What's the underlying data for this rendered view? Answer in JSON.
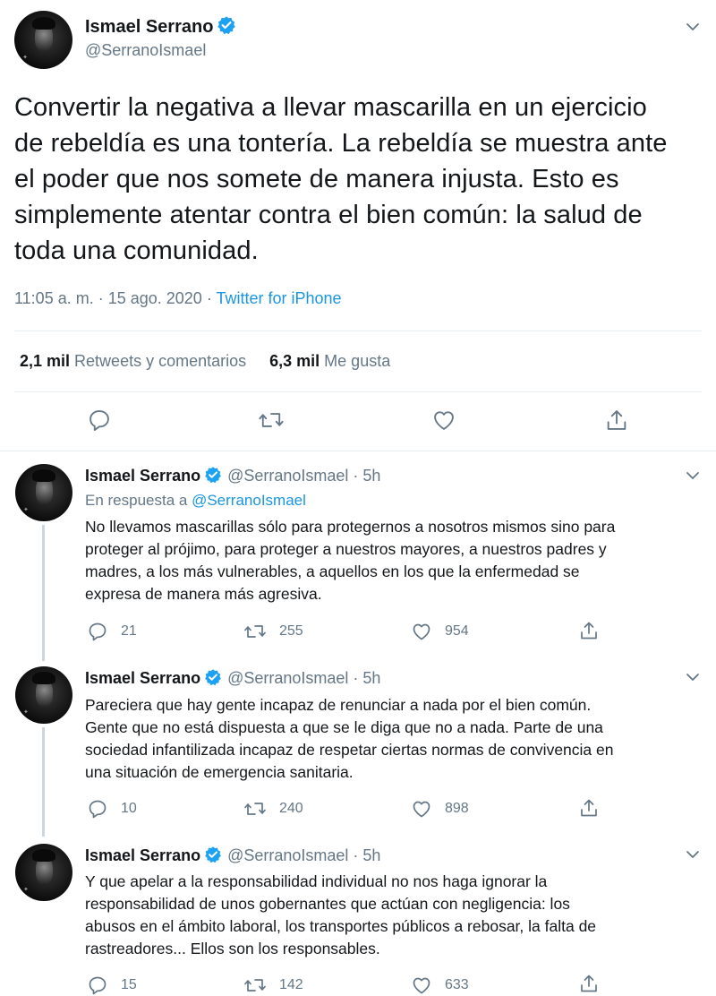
{
  "main_tweet": {
    "name": "Ismael Serrano",
    "handle": "@SerranoIsmael",
    "text_lines": [
      "Convertir la negativa a llevar mascarilla en un ejercicio",
      "de rebeldía es una tontería. La rebeldía se muestra ante",
      "el poder que nos somete de manera injusta. Esto es",
      "simplemente atentar contra el bien común: la salud de",
      "toda una comunidad."
    ],
    "time": "11:05 a. m. · 15 ago. 2020 · ",
    "source": "Twitter for iPhone",
    "retweets_count": "2,1 mil",
    "retweets_label": "Retweets y comentarios",
    "likes_count": "6,3 mil",
    "likes_label": "Me gusta"
  },
  "replies": [
    {
      "name": "Ismael Serrano",
      "handle": "@SerranoIsmael · 5h",
      "in_reply_prefix": "En respuesta a ",
      "in_reply_handle": "@SerranoIsmael",
      "text_lines": [
        "No llevamos mascarillas sólo para protegernos a nosotros mismos sino para",
        "proteger al prójimo, para proteger a nuestros mayores, a nuestros padres y",
        "madres, a los más vulnerables, a aquellos en los que la enfermedad se",
        "expresa de manera más agresiva."
      ],
      "replies": "21",
      "retweets": "255",
      "likes": "954"
    },
    {
      "name": "Ismael Serrano",
      "handle": "@SerranoIsmael · 5h",
      "text_lines": [
        "Pareciera que hay gente incapaz de renunciar a nada por el bien común.",
        "Gente que no está dispuesta a que se le diga que no a nada. Parte de una",
        "sociedad infantilizada incapaz de respetar ciertas normas de convivencia en",
        "una situación de emergencia sanitaria."
      ],
      "replies": "10",
      "retweets": "240",
      "likes": "898"
    },
    {
      "name": "Ismael Serrano",
      "handle": "@SerranoIsmael · 5h",
      "text_lines": [
        "Y que apelar a la responsabilidad individual no nos haga ignorar la",
        "responsabilidad de unos gobernantes que actúan con negligencia: los",
        "abusos en el ámbito laboral, los transportes públicos a rebosar, la falta de",
        "rastreadores... Ellos son los responsables."
      ],
      "replies": "15",
      "retweets": "142",
      "likes": "633"
    }
  ],
  "colors": {
    "text": "#14171a",
    "secondary": "#657786",
    "link": "#1b95e0",
    "verified": "#1da1f2",
    "divider": "#e6ecf0",
    "thread_line": "#ccd6dd"
  },
  "icons": [
    "verified-badge-icon",
    "chevron-down-icon",
    "reply-icon",
    "retweet-icon",
    "like-icon",
    "share-icon"
  ]
}
